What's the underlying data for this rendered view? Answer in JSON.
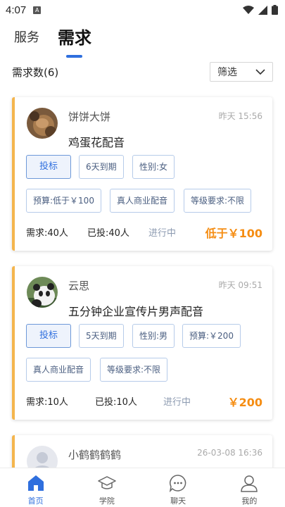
{
  "status_bar": {
    "time": "4:07",
    "indicator": "A"
  },
  "tabs": [
    {
      "label": "服务",
      "active": false
    },
    {
      "label": "需求",
      "active": true
    }
  ],
  "list": {
    "count_label": "需求数(6)",
    "filter_label": "筛选"
  },
  "cards": [
    {
      "name": "饼饼大饼",
      "time": "昨天 15:56",
      "title": "鸡蛋花配音",
      "bid_label": "投标",
      "tags": [
        "6天到期",
        "性别:女",
        "预算:低于￥100",
        "真人商业配音",
        "等级要求:不限"
      ],
      "demand": "需求:40人",
      "bids": "已投:40人",
      "status": "进行中",
      "price": "低于￥100"
    },
    {
      "name": "云思",
      "time": "昨天 09:51",
      "title": "五分钟企业宣传片男声配音",
      "bid_label": "投标",
      "tags": [
        "5天到期",
        "性别:男",
        "预算:￥200",
        "真人商业配音",
        "等级要求:不限"
      ],
      "demand": "需求:10人",
      "bids": "已投:10人",
      "status": "进行中",
      "price": "￥200"
    },
    {
      "name": "小鹤鹤鹤鹤",
      "time": "26-03-08 16:36"
    }
  ],
  "bottom_nav": [
    {
      "label": "首页",
      "icon": "home-icon",
      "active": true
    },
    {
      "label": "学院",
      "icon": "graduation-cap-icon",
      "active": false
    },
    {
      "label": "聊天",
      "icon": "chat-bubble-icon",
      "active": false
    },
    {
      "label": "我的",
      "icon": "user-icon",
      "active": false
    }
  ],
  "colors": {
    "accent": "#2f6fde",
    "card_border": "#f4b54d",
    "price": "#f58d13"
  }
}
